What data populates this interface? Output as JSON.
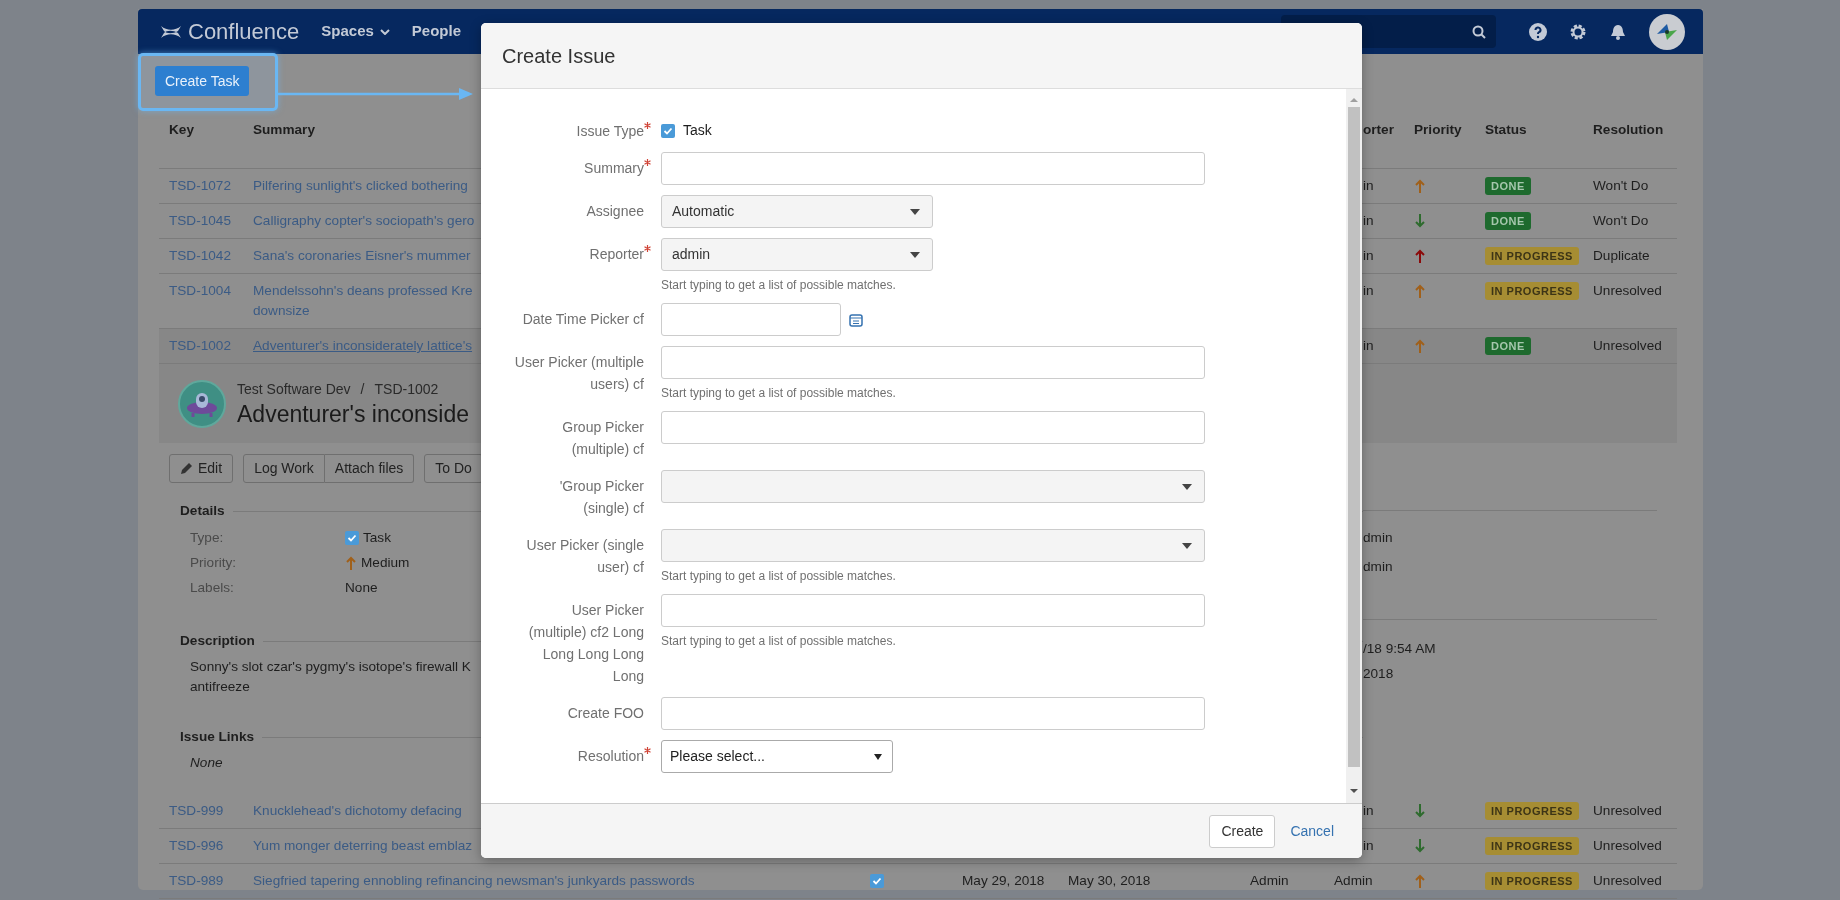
{
  "navbar": {
    "logo_text": "Confluence",
    "items": [
      {
        "label": "Spaces",
        "dropdown": true
      },
      {
        "label": "People",
        "dropdown": false
      }
    ]
  },
  "callout": {
    "button": "Create Task"
  },
  "table": {
    "header": {
      "key": "Key",
      "summary": "Summary",
      "reporter": "orter",
      "priority": "Priority",
      "status": "Status",
      "resolution": "Resolution"
    },
    "rows": [
      {
        "key": "TSD-1072",
        "summary": "Pilfering sunlight's clicked bothering",
        "selected": false,
        "reporter": "in",
        "priority": {
          "kind": "up",
          "color": "#a0601a"
        },
        "status": {
          "label": "DONE",
          "kind": "done"
        },
        "resolution": "Won't Do"
      },
      {
        "key": "TSD-1045",
        "summary": "Calligraphy copter's sociopath's gero",
        "selected": false,
        "reporter": "in",
        "priority": {
          "kind": "down",
          "color": "#2e6b2e"
        },
        "status": {
          "label": "DONE",
          "kind": "done"
        },
        "resolution": "Won't Do"
      },
      {
        "key": "TSD-1042",
        "summary": "Sana's coronaries Eisner's mummer",
        "selected": false,
        "reporter": "in",
        "priority": {
          "kind": "up",
          "color": "#8b0a0a"
        },
        "status": {
          "label": "IN PROGRESS",
          "kind": "in-progress"
        },
        "resolution": "Duplicate"
      },
      {
        "key": "TSD-1004",
        "summary": "Mendelssohn's deans professed Kre\ndownsize",
        "selected": false,
        "reporter": "in",
        "priority": {
          "kind": "up",
          "color": "#a0601a"
        },
        "status": {
          "label": "IN PROGRESS",
          "kind": "in-progress"
        },
        "resolution": "Unresolved"
      },
      {
        "key": "TSD-1002",
        "summary": "Adventurer's inconsiderately lattice's",
        "selected": true,
        "reporter": "in",
        "priority": {
          "kind": "up",
          "color": "#a0601a"
        },
        "status": {
          "label": "DONE",
          "kind": "done"
        },
        "resolution": "Unresolved"
      }
    ],
    "issue_panel": {
      "breadcrumb": [
        "Test Software Dev",
        "TSD-1002"
      ],
      "separator": "/",
      "title": "Adventurer's inconside",
      "toolbar": [
        [
          {
            "label": "Edit",
            "kind": "edit"
          }
        ],
        [
          {
            "label": "Log Work",
            "kind": "plain"
          },
          {
            "label": "Attach files",
            "kind": "plain"
          }
        ],
        [
          {
            "label": "To Do",
            "kind": "plain"
          }
        ]
      ],
      "details": {
        "heading": "Details",
        "fields": [
          {
            "label": "Type:",
            "value": "Task",
            "kind": "issue-type"
          },
          {
            "label": "Priority:",
            "value": "Medium",
            "kind": "priority",
            "priority": {
              "kind": "up",
              "color": "#a0601a"
            }
          },
          {
            "label": "Labels:",
            "value": "None",
            "kind": "text"
          }
        ],
        "side": [
          "dmin",
          "dmin"
        ]
      },
      "description": {
        "heading": "Description",
        "text": "Sonny's slot czar's pygmy's isotope's firewall K\nantifreeze",
        "side": [
          "/18 9:54 AM",
          "2018"
        ]
      },
      "issue_links": {
        "heading": "Issue Links",
        "text": "None"
      }
    },
    "more_rows": [
      {
        "key": "TSD-999",
        "summary": "Knucklehead's dichotomy defacing",
        "selected": false,
        "reporter": "in",
        "priority": {
          "kind": "down",
          "color": "#2e6b2e"
        },
        "status": {
          "label": "IN PROGRESS",
          "kind": "in-progress"
        },
        "resolution": "Unresolved"
      },
      {
        "key": "TSD-996",
        "summary": "Yum monger deterring beast emblaz",
        "selected": false,
        "reporter": "in",
        "priority": {
          "kind": "down",
          "color": "#2e6b2e"
        },
        "status": {
          "label": "IN PROGRESS",
          "kind": "in-progress"
        },
        "resolution": "Unresolved"
      },
      {
        "key": "TSD-989",
        "summary": "Siegfried tapering ennobling refinancing newsman's junkyards passwords",
        "selected": false,
        "watched": true,
        "created": "May 29, 2018",
        "updated": "May 30, 2018",
        "assignee": "Admin",
        "reporter": "Admin",
        "priority": {
          "kind": "up",
          "color": "#a0601a"
        },
        "status": {
          "label": "IN PROGRESS",
          "kind": "in-progress"
        },
        "resolution": "Unresolved"
      }
    ]
  },
  "modal": {
    "title": "Create Issue",
    "fields": [
      {
        "label": "Issue Type",
        "required": true,
        "kind": "issue-type",
        "value": "Task"
      },
      {
        "label": "Summary",
        "required": true,
        "kind": "text"
      },
      {
        "label": "Assignee",
        "required": false,
        "kind": "select",
        "value": "Automatic"
      },
      {
        "label": "Reporter",
        "required": true,
        "kind": "select",
        "value": "admin",
        "hint": "Start typing to get a list of possible matches."
      },
      {
        "label": "Date Time Picker cf",
        "required": false,
        "kind": "date"
      },
      {
        "label": "User Picker (multiple users) cf",
        "required": false,
        "kind": "text",
        "hint": "Start typing to get a list of possible matches."
      },
      {
        "label": "Group Picker (multiple) cf",
        "required": false,
        "kind": "text"
      },
      {
        "label": "'Group Picker (single) cf",
        "required": false,
        "kind": "wide-select"
      },
      {
        "label": "User Picker (single user) cf",
        "required": false,
        "kind": "wide-select",
        "hint": "Start typing to get a list of possible matches."
      },
      {
        "label": "User Picker (multiple) cf2 Long Long Long Long Long",
        "required": false,
        "kind": "text",
        "hint": "Start typing to get a list of possible matches."
      },
      {
        "label": "Create FOO",
        "required": false,
        "kind": "text"
      },
      {
        "label": "Resolution",
        "required": true,
        "kind": "native-select",
        "value": "Please select..."
      }
    ],
    "buttons": [
      {
        "label": "Create",
        "kind": "button"
      },
      {
        "label": "Cancel",
        "kind": "link"
      }
    ]
  }
}
